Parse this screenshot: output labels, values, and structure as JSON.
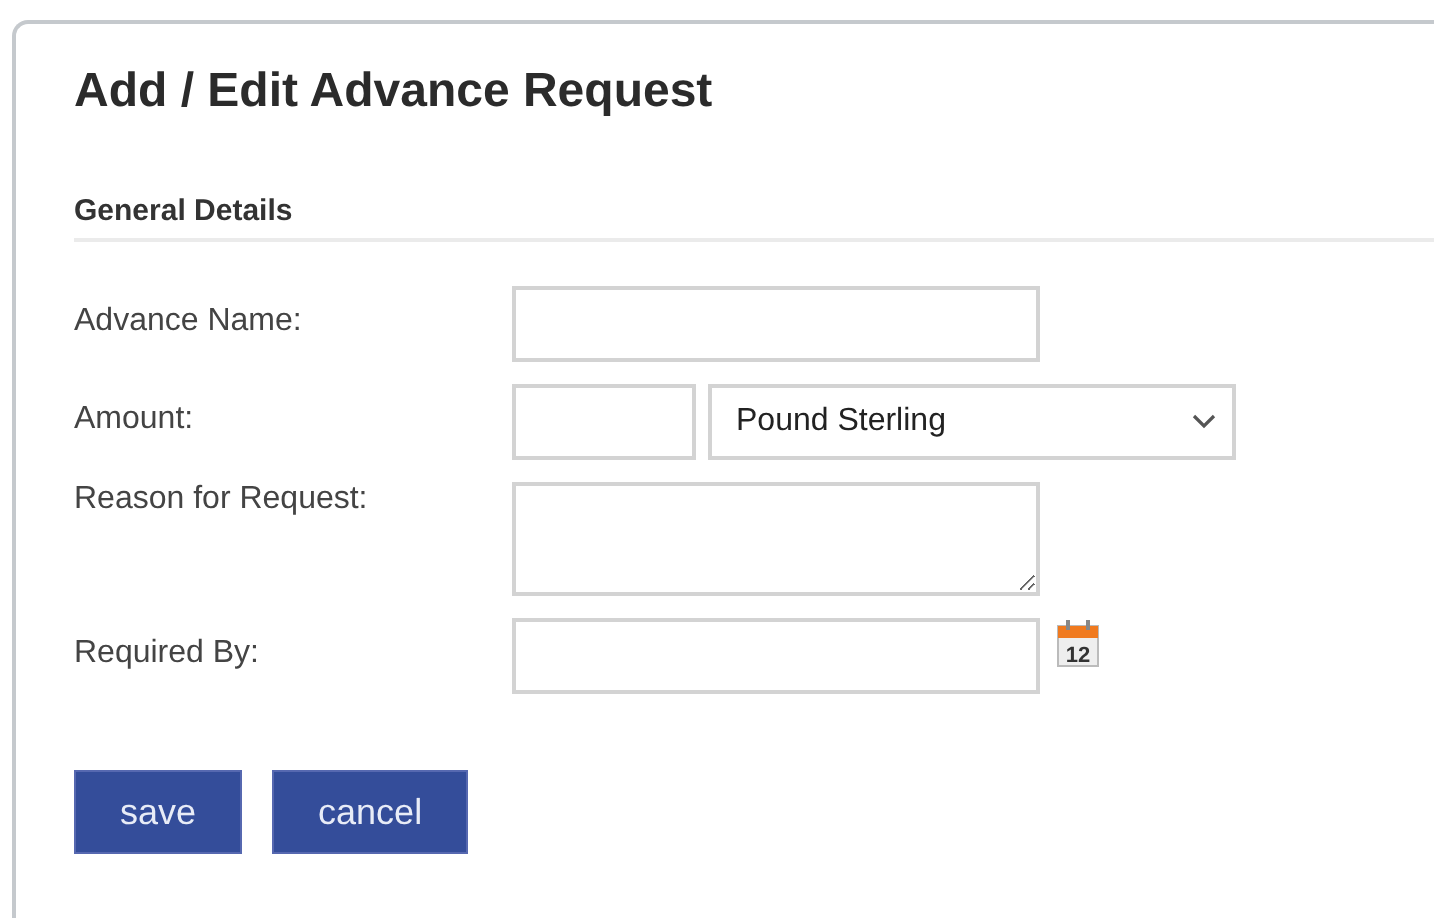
{
  "title": "Add / Edit Advance Request",
  "section": "General Details",
  "fields": [
    {
      "kind": "text",
      "label": "Advance Name:"
    },
    {
      "kind": "amount",
      "label": "Amount:",
      "currency": "Pound Sterling"
    },
    {
      "kind": "textarea",
      "label": "Reason for Request:"
    },
    {
      "kind": "date",
      "label": "Required By:",
      "calendar_day": "12"
    }
  ],
  "buttons": [
    "save",
    "cancel"
  ]
}
